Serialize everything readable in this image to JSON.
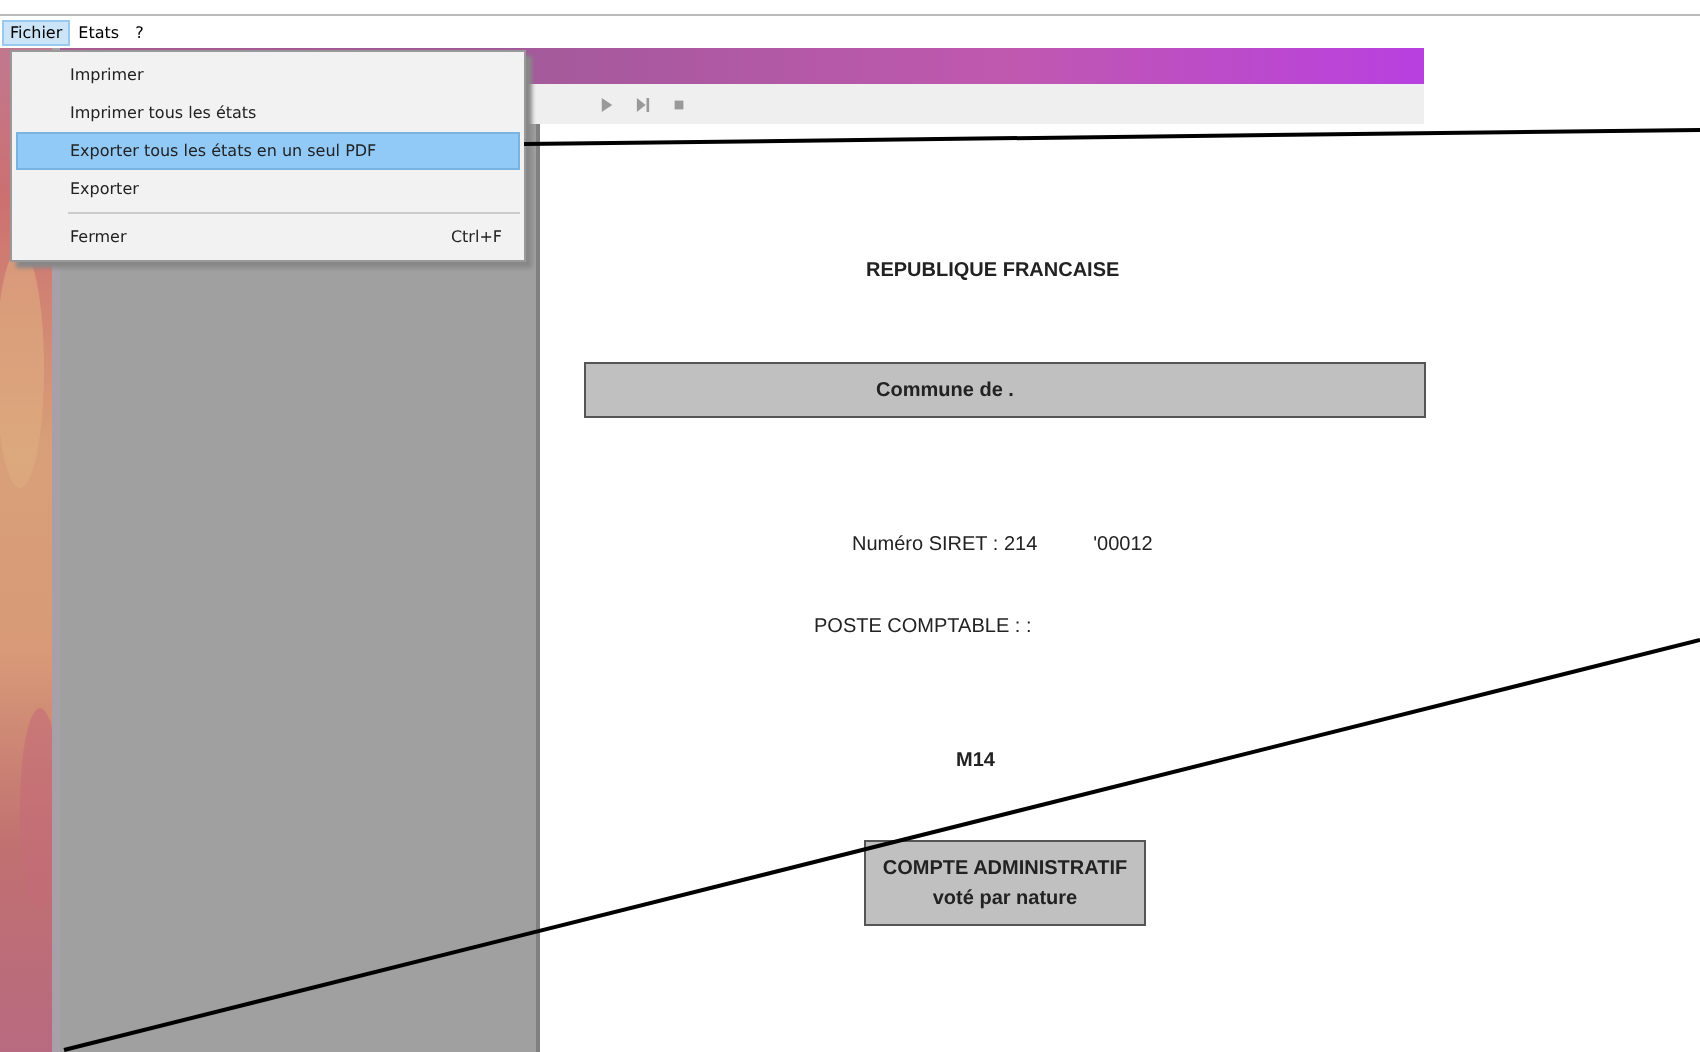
{
  "menubar": [
    {
      "label": "Fichier",
      "selected": true
    },
    {
      "label": "Etats",
      "selected": false
    },
    {
      "label": "?",
      "selected": false
    }
  ],
  "menu": [
    {
      "kind": "item",
      "label": "Imprimer",
      "selected": false
    },
    {
      "kind": "item",
      "label": "Imprimer tous les états",
      "selected": false
    },
    {
      "kind": "item",
      "label": "Exporter tous les états en un seul PDF",
      "selected": true
    },
    {
      "kind": "item",
      "label": "Exporter",
      "selected": false
    },
    {
      "kind": "separator"
    },
    {
      "kind": "item",
      "label": "Fermer",
      "shortcut": "Ctrl+F",
      "selected": false
    }
  ],
  "toolbar": [
    {
      "kind": "play"
    },
    {
      "kind": "last"
    },
    {
      "kind": "stop"
    }
  ],
  "document": {
    "heading": "REPUBLIQUE FRANCAISE",
    "commune": "Commune de .",
    "siret_label": "Numéro SIRET : 214",
    "siret_end": "'00012",
    "poste": "POSTE COMPTABLE : :",
    "nomenclature": "M14",
    "title": "COMPTE ADMINISTRATIF",
    "subtitle": "voté par nature"
  }
}
